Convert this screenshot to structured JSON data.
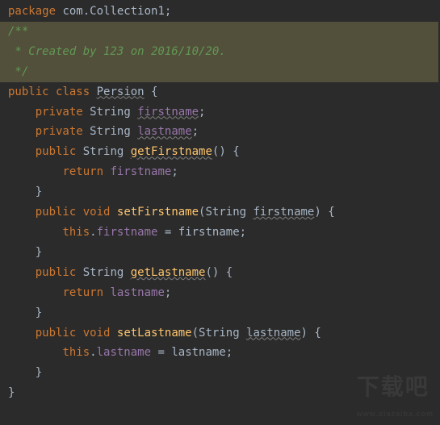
{
  "pkg": {
    "kw": "package",
    "name": "com.Collection1",
    "semi": ";"
  },
  "doc": {
    "open": "/**",
    "line": " * Created by 123 on 2016/10/20.",
    "close": " */"
  },
  "cls": {
    "mod": "public",
    "kw": "class",
    "name": "Persion",
    "open": "{",
    "close": "}"
  },
  "field1": {
    "mod": "private",
    "type": "String",
    "name": "firstname",
    "semi": ";"
  },
  "field2": {
    "mod": "private",
    "type": "String",
    "name": "lastname",
    "semi": ";"
  },
  "getter1": {
    "mod": "public",
    "ret": "String",
    "name": "getFirstname",
    "open": "{",
    "body_kw": "return",
    "body_field": "firstname",
    "semi": ";",
    "close": "}"
  },
  "setter1": {
    "mod": "public",
    "ret": "void",
    "name": "setFirstname",
    "ptype": "String",
    "pname": "firstname",
    "open": "{",
    "this": "this",
    "field": "firstname",
    "assign": "=",
    "rhs": "firstname",
    "semi": ";",
    "close": "}"
  },
  "getter2": {
    "mod": "public",
    "ret": "String",
    "name": "getLastname",
    "open": "{",
    "body_kw": "return",
    "body_field": "lastname",
    "semi": ";",
    "close": "}"
  },
  "setter2": {
    "mod": "public",
    "ret": "void",
    "name": "setLastname",
    "ptype": "String",
    "pname": "lastname",
    "open": "{",
    "this": "this",
    "field": "lastname",
    "assign": "=",
    "rhs": "lastname",
    "semi": ";",
    "close": "}"
  },
  "parens": {
    "lp": "(",
    "rp": ")"
  },
  "blank": "",
  "watermark": {
    "main": "下载吧",
    "sub": "www.xiazaiba.com"
  }
}
